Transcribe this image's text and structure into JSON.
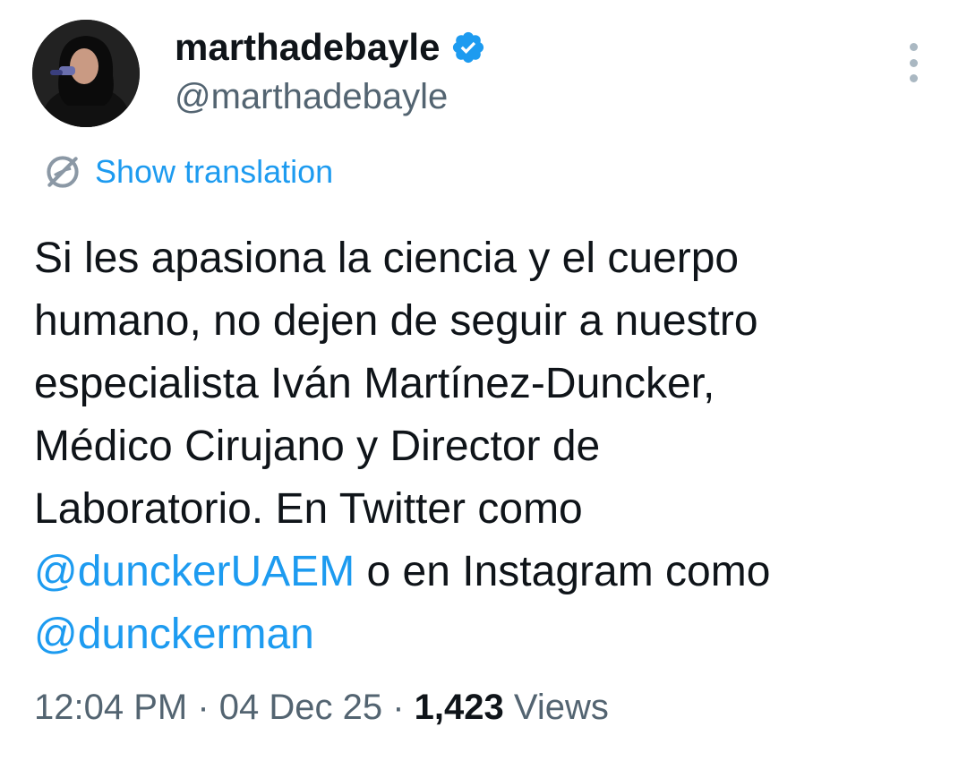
{
  "author": {
    "display_name": "marthadebayle",
    "handle": "@marthadebayle",
    "verified": true,
    "avatar_icon": "profile-photo-woman-with-microphone"
  },
  "menu": {
    "icon": "more-vertical-icon"
  },
  "translation": {
    "icon": "globe-translate-icon",
    "label": "Show translation"
  },
  "tweet": {
    "line1": "Si les apasiona la ciencia y el cuerpo",
    "line2": "humano, no dejen de seguir a nuestro",
    "line3": "especialista Iván Martínez-Duncker,",
    "line4": "Médico Cirujano y Director de",
    "line5": "Laboratorio. En Twitter como",
    "mention1": "@dunckerUAEM",
    "line6_rest": " o en Instagram como",
    "mention2": "@dunckerman"
  },
  "meta": {
    "time": "12:04 PM",
    "separator": " · ",
    "date": "04 Dec 25",
    "views_count": "1,423",
    "views_label": " Views"
  },
  "colors": {
    "accent": "#1d9bf0",
    "text": "#0f1419",
    "secondary": "#536471"
  }
}
